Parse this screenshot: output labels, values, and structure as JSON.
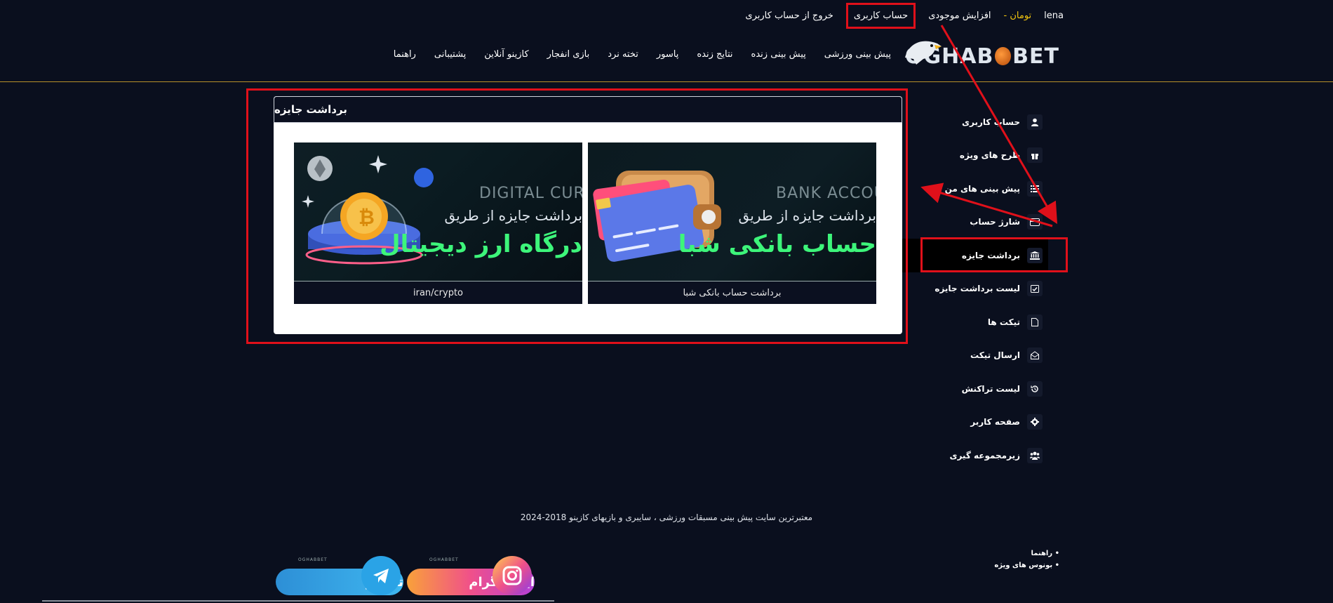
{
  "topbar": {
    "username": "lena",
    "balance_unit": "تومان -",
    "increase_balance": "افزایش موجودی",
    "user_account": "حساب کاربری",
    "logout": "خروج از حساب کاربری"
  },
  "logo": {
    "text_left": "OGHAB",
    "text_right": "BET"
  },
  "nav": {
    "items": [
      "پیش بینی ورزشی",
      "پیش بینی زنده",
      "نتایج زنده",
      "پاسور",
      "تخته نرد",
      "بازی انفجار",
      "کازینو آنلاین",
      "پشتیبانی",
      "راهنما"
    ]
  },
  "sidebar": {
    "items": [
      {
        "label": "حساب کاربری",
        "icon": "user-icon"
      },
      {
        "label": "طرح های ویژه",
        "icon": "gift-icon"
      },
      {
        "label": "پیش بینی های من",
        "icon": "list-icon"
      },
      {
        "label": "شارژ حساب",
        "icon": "card-icon"
      },
      {
        "label": "برداشت جایزه",
        "icon": "bank-icon"
      },
      {
        "label": "لیست برداشت جایزه",
        "icon": "calendar-check-icon"
      },
      {
        "label": "تیکت ها",
        "icon": "file-icon"
      },
      {
        "label": "ارسال تیکت",
        "icon": "envelope-open-icon"
      },
      {
        "label": "لیست تراکنش",
        "icon": "history-icon"
      },
      {
        "label": "صفحه کاربر",
        "icon": "gear-icon"
      },
      {
        "label": "زیرمجموعه گیری",
        "icon": "users-icon"
      }
    ],
    "active_index": 4
  },
  "main": {
    "title": "برداشت جایزه",
    "cards": [
      {
        "caption": "برداشت حساب بانکی شبا",
        "eng": "BANK ACCOUNT",
        "line1": "برداشت جایزه از طریق",
        "line2": "حساب بانکی شبا"
      },
      {
        "caption": "iran/crypto",
        "eng": "DIGITAL CURRENCY",
        "line1": "برداشت جایزه از طریق",
        "line2": "درگاه ارز دیجیتال"
      }
    ]
  },
  "footer": {
    "text": "معتبرترین سایت پیش بینی مسبقات ورزشی ، سایبری و بازیهای کازینو 2018-2024",
    "links": [
      "• راهنما",
      "• بونوس های ویژه"
    ],
    "telegram": "تلگرام",
    "instagram": "اینستاگرام",
    "brand_small": "OGHABBET"
  },
  "colors": {
    "highlight": "#e0101a",
    "accent_green": "#3df57a",
    "gold_line": "#b8902a",
    "balance": "#f1c40f"
  }
}
